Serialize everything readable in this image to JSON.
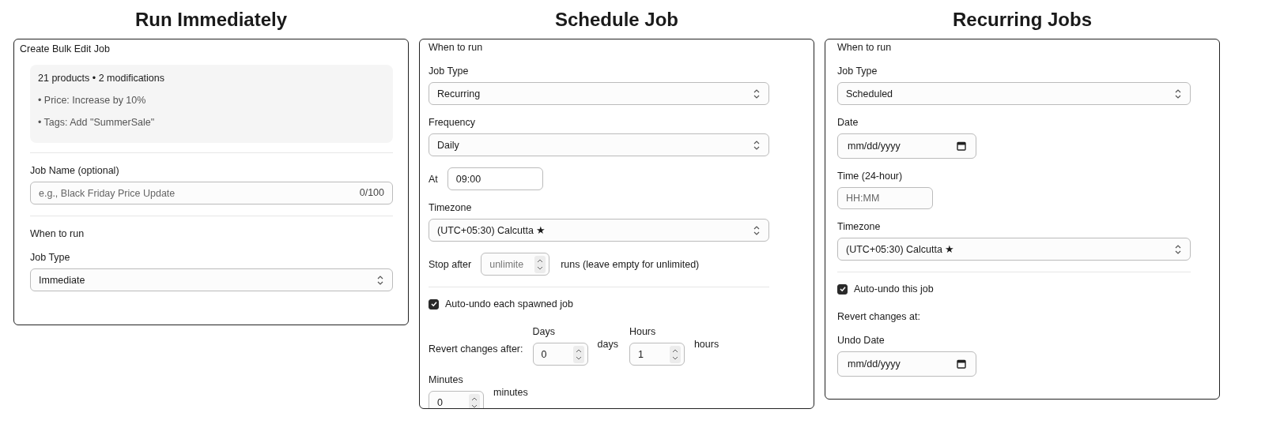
{
  "panels": [
    {
      "heading": "Run Immediately",
      "title": "Create Bulk Edit Job",
      "blocks": [
        {
          "kind": "summary",
          "headline": "21 products • 2 modifications",
          "items": [
            "• Price: Increase by 10%",
            "• Tags: Add \"SummerSale\""
          ]
        },
        {
          "kind": "divider"
        },
        {
          "kind": "text_field",
          "label": "Job Name (optional)",
          "placeholder": "e.g., Black Friday Price Update",
          "counter": "0/100"
        },
        {
          "kind": "divider"
        },
        {
          "kind": "section",
          "text": "When to run"
        },
        {
          "kind": "select",
          "label": "Job Type",
          "value": "Immediate"
        }
      ]
    },
    {
      "heading": "Schedule Job",
      "blocks": [
        {
          "kind": "section",
          "text": "When to run"
        },
        {
          "kind": "select",
          "label": "Job Type",
          "value": "Recurring"
        },
        {
          "kind": "select",
          "label": "Frequency",
          "value": "Daily"
        },
        {
          "kind": "inline_field",
          "label": "At",
          "value": "09:00"
        },
        {
          "kind": "select",
          "label": "Timezone",
          "value": "(UTC+05:30) Calcutta ★"
        },
        {
          "kind": "stepper_row",
          "label": "Stop after",
          "placeholder": "unlimite",
          "suffix": "runs (leave empty for unlimited)"
        },
        {
          "kind": "divider"
        },
        {
          "kind": "checkbox",
          "label": "Auto-undo each spawned job",
          "checked": true
        },
        {
          "kind": "duration",
          "label": "Revert changes after:",
          "units": [
            {
              "label": "Days",
              "value": "0",
              "suffix": "days"
            },
            {
              "label": "Hours",
              "value": "1",
              "suffix": "hours"
            },
            {
              "label": "Minutes",
              "value": "0",
              "suffix": "minutes"
            }
          ]
        }
      ]
    },
    {
      "heading": "Recurring Jobs",
      "blocks": [
        {
          "kind": "section",
          "text": "When to run"
        },
        {
          "kind": "select",
          "label": "Job Type",
          "value": "Scheduled"
        },
        {
          "kind": "date_field",
          "label": "Date",
          "value": "mm/dd/yyyy"
        },
        {
          "kind": "short_field",
          "label": "Time (24-hour)",
          "placeholder": "HH:MM"
        },
        {
          "kind": "select",
          "label": "Timezone",
          "value": "(UTC+05:30) Calcutta ★"
        },
        {
          "kind": "divider"
        },
        {
          "kind": "checkbox",
          "label": "Auto-undo this job",
          "checked": true
        },
        {
          "kind": "section",
          "text": "Revert changes at:"
        },
        {
          "kind": "date_field",
          "label": "Undo Date",
          "value": "mm/dd/yyyy"
        }
      ]
    }
  ]
}
